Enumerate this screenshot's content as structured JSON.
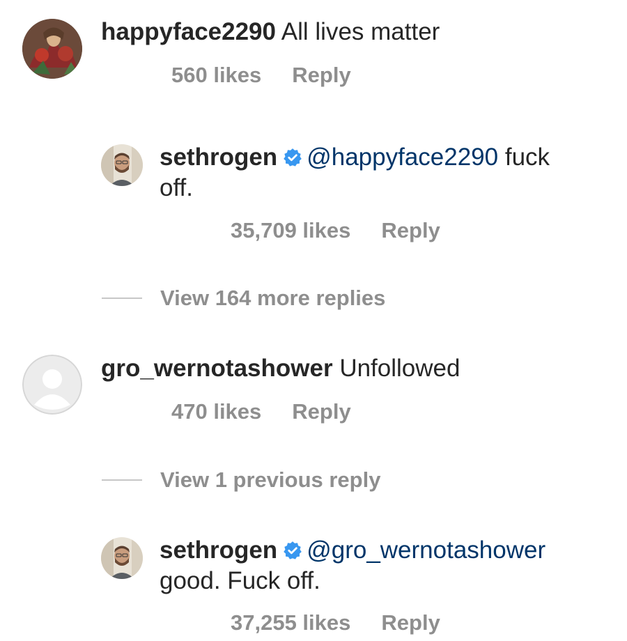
{
  "comments": [
    {
      "username": "happyface2290",
      "text": "All lives matter",
      "likes": "560 likes",
      "reply": "Reply"
    },
    {
      "username": "sethrogen",
      "mention": "@happyface2290",
      "text_line1": "fuck",
      "text_line2": "off.",
      "likes": "35,709 likes",
      "reply": "Reply"
    },
    {
      "view_more": "View 164 more replies"
    },
    {
      "username": "gro_wernotashower",
      "text": "Unfollowed",
      "likes": "470 likes",
      "reply": "Reply"
    },
    {
      "view_previous": "View 1 previous reply"
    },
    {
      "username": "sethrogen",
      "mention": "@gro_wernotashower",
      "text_line2": "good. Fuck off.",
      "likes": "37,255 likes",
      "reply": "Reply"
    }
  ],
  "colors": {
    "text": "#262626",
    "meta": "#8e8e8e",
    "mention": "#003569",
    "verified": "#3897f0"
  }
}
